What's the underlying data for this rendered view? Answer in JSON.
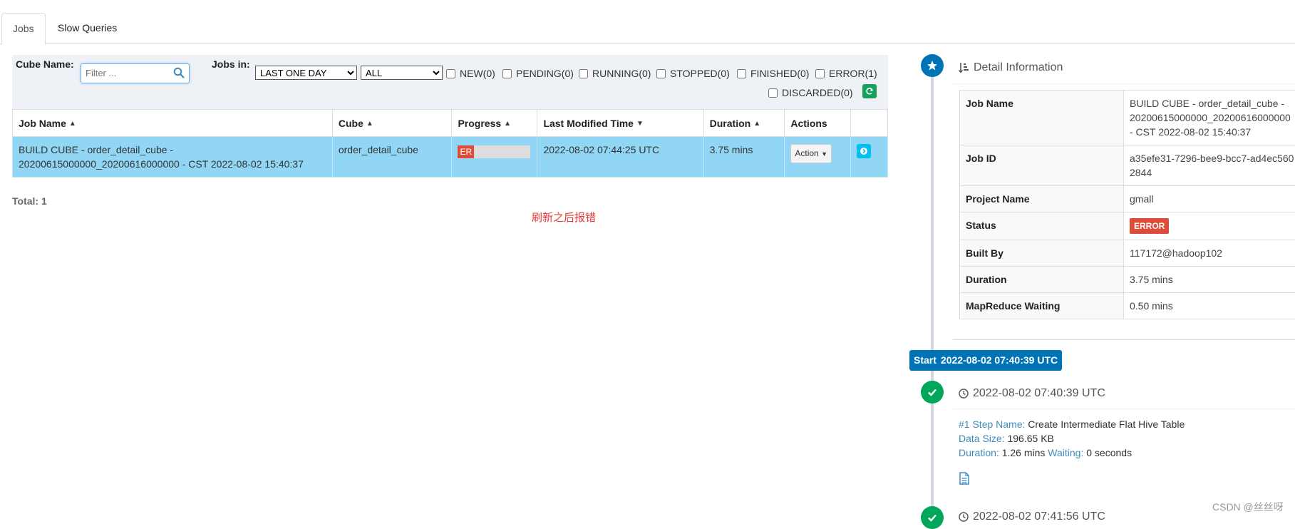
{
  "tabs": [
    {
      "label": "Jobs",
      "active": true
    },
    {
      "label": "Slow Queries",
      "active": false
    }
  ],
  "filter": {
    "cube_name_label": "Cube Name:",
    "search_placeholder": "Filter ...",
    "jobs_in_label": "Jobs in:",
    "time_range_selected": "LAST ONE DAY",
    "time_range_options": [
      "LAST ONE DAY"
    ],
    "scope_selected": "ALL",
    "scope_options": [
      "ALL"
    ],
    "status_filters": [
      {
        "label": "NEW(0)"
      },
      {
        "label": "PENDING(0)"
      },
      {
        "label": "RUNNING(0)"
      },
      {
        "label": "STOPPED(0)"
      },
      {
        "label": "FINISHED(0)"
      },
      {
        "label": "ERROR(1)"
      },
      {
        "label": "DISCARDED(0)"
      }
    ]
  },
  "jobs_table": {
    "columns": [
      "Job Name",
      "Cube",
      "Progress",
      "Last Modified Time",
      "Duration",
      "Actions"
    ],
    "rows": [
      {
        "job_name_line1": "BUILD CUBE - order_detail_cube -",
        "job_name_line2": "20200615000000_20200616000000 - CST 2022-08-02 15:40:37",
        "cube": "order_detail_cube",
        "progress_label": "ER",
        "progress_fraction": 0.22,
        "last_modified": "2022-08-02 07:44:25 UTC",
        "duration": "3.75 mins",
        "action_label": "Action"
      }
    ],
    "total": "Total: 1"
  },
  "annotation": "刷新之后报错",
  "detail": {
    "title": "Detail Information",
    "rows": [
      {
        "key": "Job Name",
        "value": "BUILD CUBE - order_detail_cube - 20200615000000_20200616000000 - CST 2022-08-02 15:40:37"
      },
      {
        "key": "Job ID",
        "value": "a35efe31-7296-bee9-bcc7-ad4ec5602844"
      },
      {
        "key": "Project Name",
        "value": "gmall"
      },
      {
        "key": "Status",
        "value": "ERROR"
      },
      {
        "key": "Built By",
        "value": "117172@hadoop102"
      },
      {
        "key": "Duration",
        "value": "3.75 mins"
      },
      {
        "key": "MapReduce Waiting",
        "value": "0.50 mins"
      }
    ]
  },
  "timeline": {
    "start_label": "Start",
    "start_time": "2022-08-02 07:40:39 UTC",
    "step1": {
      "time": "2022-08-02 07:40:39 UTC",
      "step_name_label": "#1 Step Name:",
      "step_name": "Create Intermediate Flat Hive Table",
      "data_size_label": "Data Size:",
      "data_size": "196.65 KB",
      "duration_label": "Duration:",
      "duration": "1.26 mins",
      "waiting_label": "Waiting:",
      "waiting": "0 seconds"
    },
    "step2": {
      "time": "2022-08-02 07:41:56 UTC"
    }
  },
  "watermark": "CSDN @丝丝呀",
  "colors": {
    "selected_row": "#91d7f5",
    "error": "#dd4b39",
    "timeline_blue": "#0073b7",
    "timeline_green": "#00a65a",
    "link_blue": "#3c8dbc",
    "annotation_red": "#e53935"
  },
  "icons": [
    "search-icon",
    "refresh-icon",
    "sort-icon",
    "info-icon",
    "star-icon",
    "detail-sort-icon",
    "check-icon",
    "clock-icon",
    "document-icon"
  ]
}
